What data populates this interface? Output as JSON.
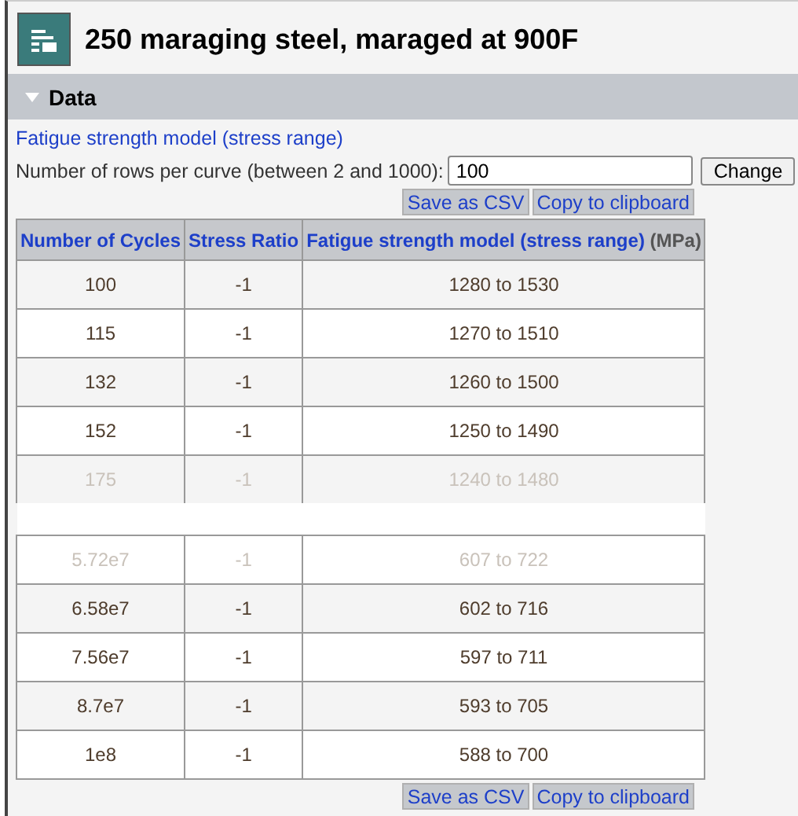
{
  "title": "250 maraging steel, maraged at 900F",
  "section": {
    "label": "Data",
    "expanded": true
  },
  "model_title": "Fatigue strength model (stress range)",
  "rows_field": {
    "label": "Number of rows per curve (between 2 and 1000):",
    "value": "100",
    "button": "Change"
  },
  "actions_top": [
    "Save as CSV",
    "Copy to clipboard"
  ],
  "table": {
    "columns": [
      {
        "label": "Number of Cycles"
      },
      {
        "label": "Stress Ratio"
      },
      {
        "label": "Fatigue strength model (stress range)",
        "unit": "(MPa)"
      }
    ],
    "rows_before_break": [
      {
        "cells": [
          "100",
          "-1",
          "1280 to 1530"
        ],
        "faded": false
      },
      {
        "cells": [
          "115",
          "-1",
          "1270 to 1510"
        ],
        "faded": false
      },
      {
        "cells": [
          "132",
          "-1",
          "1260 to 1500"
        ],
        "faded": false
      },
      {
        "cells": [
          "152",
          "-1",
          "1250 to 1490"
        ],
        "faded": false
      },
      {
        "cells": [
          "175",
          "-1",
          "1240 to 1480"
        ],
        "faded": true
      }
    ],
    "rows_after_break": [
      {
        "cells": [
          "5.72e7",
          "-1",
          "607 to 722"
        ],
        "faded": true
      },
      {
        "cells": [
          "6.58e7",
          "-1",
          "602 to 716"
        ],
        "faded": false
      },
      {
        "cells": [
          "7.56e7",
          "-1",
          "597 to 711"
        ],
        "faded": false
      },
      {
        "cells": [
          "8.7e7",
          "-1",
          "593 to 705"
        ],
        "faded": false
      },
      {
        "cells": [
          "1e8",
          "-1",
          "588 to 700"
        ],
        "faded": false
      }
    ]
  },
  "actions_bottom": [
    "Save as CSV",
    "Copy to clipboard"
  ]
}
